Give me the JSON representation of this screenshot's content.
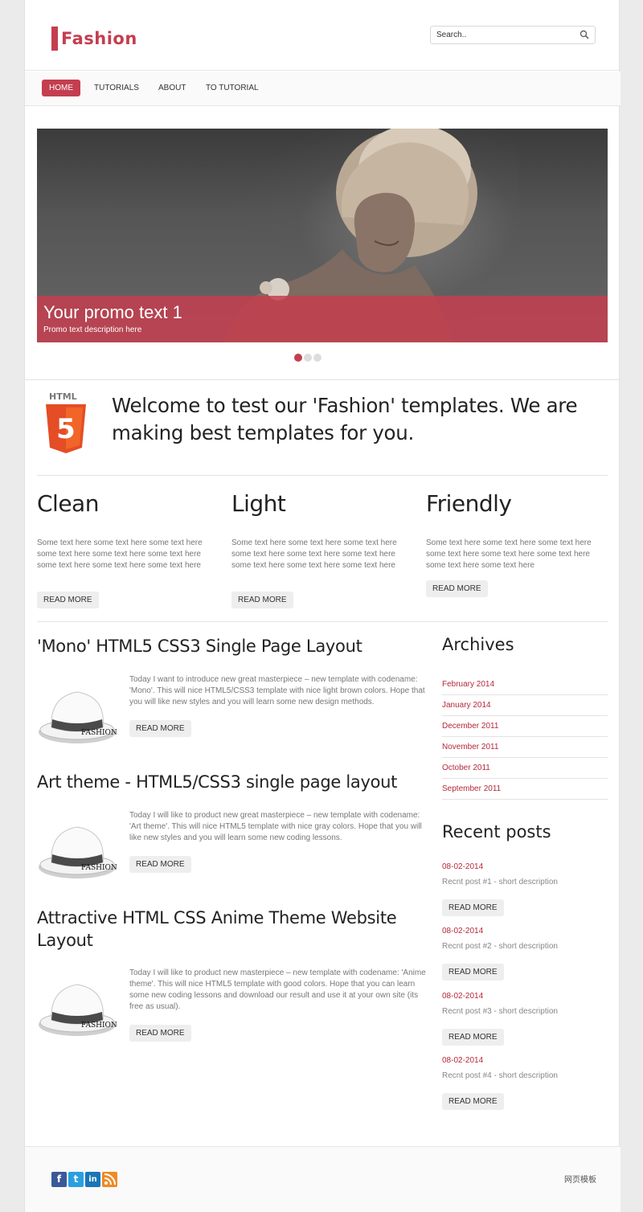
{
  "colors": {
    "accent": "#c43e4f",
    "accent_dark": "#b5283a",
    "text_dark": "#222222",
    "text_muted": "#777777"
  },
  "header": {
    "logo_text": "Fashion",
    "search_placeholder": "Search..",
    "search_icon": "search-icon"
  },
  "nav": {
    "items": [
      {
        "label": "HOME",
        "active": true
      },
      {
        "label": "TUTORIALS",
        "active": false
      },
      {
        "label": "ABOUT",
        "active": false
      },
      {
        "label": "TO TUTORIAL",
        "active": false
      }
    ]
  },
  "slider": {
    "title": "Your promo text 1",
    "description": "Promo text description here",
    "slide_count": 3,
    "active_slide": 1
  },
  "welcome": {
    "badge_label": "HTML",
    "badge_number": "5",
    "text": "Welcome to test our 'Fashion' templates. We are making best templates for you."
  },
  "features": [
    {
      "title": "Clean",
      "text": "Some text here some text here some text here some text here some text here some text here some text here some text here some text here",
      "button": "READ MORE"
    },
    {
      "title": "Light",
      "text": "Some text here some text here some text here some text here some text here some text here some text here some text here some text here",
      "button": "READ MORE"
    },
    {
      "title": "Friendly",
      "text": "Some text here some text here some text here some text here some text here some text here some text here some text here",
      "button": "READ MORE"
    }
  ],
  "posts": [
    {
      "title": "'Mono' HTML5 CSS3 Single Page Layout",
      "text": "Today I want to introduce new great masterpiece – new template with codename: 'Mono'. This will nice HTML5/CSS3 template with nice light brown colors. Hope that you will like new styles and you will learn some new design methods.",
      "button": "READ MORE",
      "image_label": "FASHION"
    },
    {
      "title": "Art theme - HTML5/CSS3 single page layout",
      "text": "Today I will like to product new great masterpiece – new template with codename: 'Art theme'. This will nice HTML5 template with nice gray colors. Hope that you will like new styles and you will learn some new coding lessons.",
      "button": "READ MORE",
      "image_label": "FASHION"
    },
    {
      "title": "Attractive HTML CSS Anime Theme Website Layout",
      "text": "Today I will like to product new masterpiece – new template with codename: 'Anime theme'. This will nice HTML5 template with good colors. Hope that you can learn some new coding lessons and download our result and use it at your own site (its free as usual).",
      "button": "READ MORE",
      "image_label": "FASHION"
    }
  ],
  "sidebar": {
    "archives_title": "Archives",
    "archives": [
      "February 2014",
      "January 2014",
      "December 2011",
      "November 2011",
      "October 2011",
      "September 2011"
    ],
    "recent_title": "Recent posts",
    "recent": [
      {
        "date": "08-02-2014",
        "text": "Recnt post #1 - short description",
        "button": "READ MORE"
      },
      {
        "date": "08-02-2014",
        "text": "Recnt post #2 - short description",
        "button": "READ MORE"
      },
      {
        "date": "08-02-2014",
        "text": "Recnt post #3 - short description",
        "button": "READ MORE"
      },
      {
        "date": "08-02-2014",
        "text": "Recnt post #4 - short description",
        "button": "READ MORE"
      }
    ]
  },
  "footer": {
    "social": [
      {
        "icon": "facebook-icon",
        "glyph": "f",
        "color": "#3b5998"
      },
      {
        "icon": "twitter-icon",
        "glyph": "t",
        "color": "#2aa0e0"
      },
      {
        "icon": "linkedin-icon",
        "glyph": "in",
        "color": "#1a76b5"
      },
      {
        "icon": "rss-icon",
        "glyph": "",
        "color": "#f08a24"
      }
    ],
    "link": "网页模板"
  }
}
